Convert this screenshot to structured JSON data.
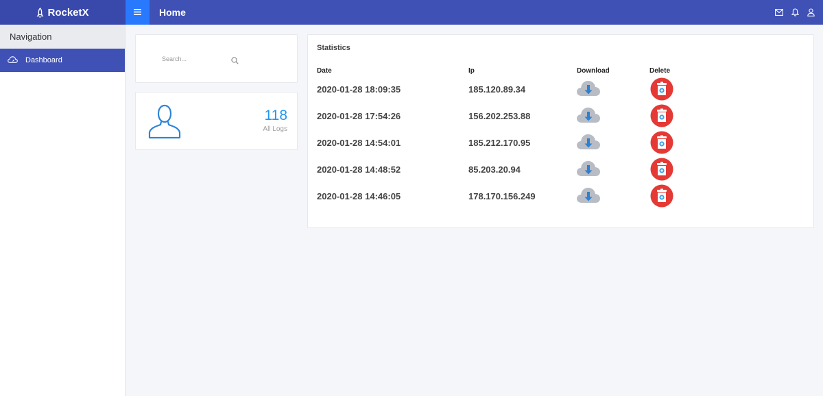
{
  "app": {
    "brand": "RocketX",
    "page_title": "Home"
  },
  "header": {
    "icons": [
      "mail-icon",
      "bell-icon",
      "user-icon"
    ]
  },
  "sidebar": {
    "title": "Navigation",
    "items": [
      {
        "label": "Dashboard",
        "icon": "cloud-dashboard-icon",
        "active": true
      }
    ]
  },
  "search": {
    "placeholder": "Search..."
  },
  "logs": {
    "count": "118",
    "label": "All Logs"
  },
  "stats": {
    "title": "Statistics",
    "columns": [
      "Date",
      "Ip",
      "Download",
      "Delete"
    ],
    "rows": [
      {
        "date": "2020-01-28 18:09:35",
        "ip": "185.120.89.34"
      },
      {
        "date": "2020-01-28 17:54:26",
        "ip": "156.202.253.88"
      },
      {
        "date": "2020-01-28 14:54:01",
        "ip": "185.212.170.95"
      },
      {
        "date": "2020-01-28 14:48:52",
        "ip": "85.203.20.94"
      },
      {
        "date": "2020-01-28 14:46:05",
        "ip": "178.170.156.249"
      }
    ]
  },
  "colors": {
    "brand": "#3949ab",
    "header": "#3f51b5",
    "menu_button": "#2979ff",
    "accent": "#2196f3",
    "delete": "#e53935",
    "download_cloud": "#b8bcc4"
  }
}
